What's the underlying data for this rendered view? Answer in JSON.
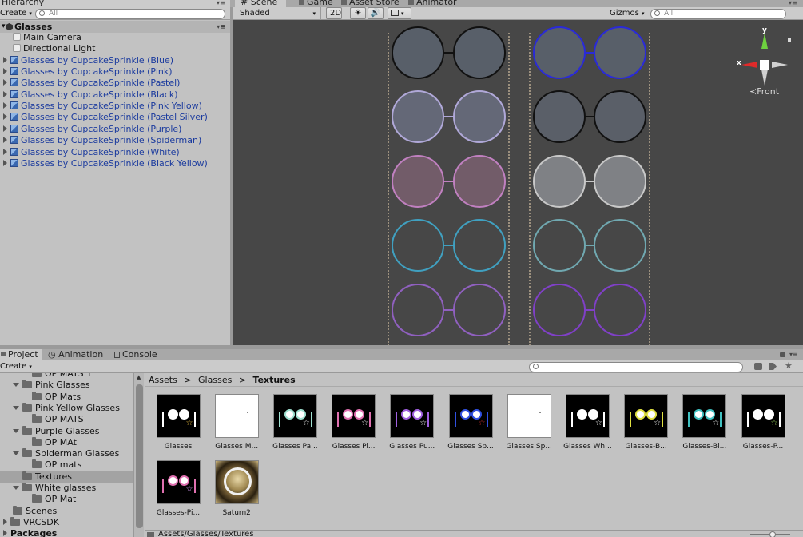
{
  "hierarchy": {
    "tab_label": "Hierarchy",
    "create_label": "Create",
    "search_placeholder": "All",
    "scene_name": "Glasses",
    "items": [
      {
        "label": "Main Camera",
        "prefab": false
      },
      {
        "label": "Directional Light",
        "prefab": false
      },
      {
        "label": "Glasses by CupcakeSprinkle (Blue)",
        "prefab": true
      },
      {
        "label": "Glasses by CupcakeSprinkle (Pink)",
        "prefab": true
      },
      {
        "label": "Glasses by CupcakeSprinkle (Pastel)",
        "prefab": true
      },
      {
        "label": "Glasses by CupcakeSprinkle (Black)",
        "prefab": true
      },
      {
        "label": "Glasses by CupcakeSprinkle (Pink Yellow)",
        "prefab": true
      },
      {
        "label": "Glasses by CupcakeSprinkle (Pastel Silver)",
        "prefab": true
      },
      {
        "label": "Glasses by CupcakeSprinkle (Purple)",
        "prefab": true
      },
      {
        "label": "Glasses by CupcakeSprinkle (Spiderman)",
        "prefab": true
      },
      {
        "label": "Glasses by CupcakeSprinkle (White)",
        "prefab": true
      },
      {
        "label": "Glasses by CupcakeSprinkle (Black Yellow)",
        "prefab": true
      }
    ]
  },
  "scene": {
    "tabs": [
      "Scene",
      "Game",
      "Asset Store",
      "Animator"
    ],
    "shading_mode": "Shaded",
    "mode_2d": "2D",
    "gizmos_label": "Gizmos",
    "search_placeholder": "All",
    "gizmo_axis_y": "y",
    "gizmo_axis_x": "x",
    "view_label": "Front",
    "background_color": "#474747"
  },
  "project": {
    "tabs": [
      "Project",
      "Animation",
      "Console"
    ],
    "create_label": "Create",
    "tree": [
      {
        "label": "OP MATS 1",
        "depth": 2,
        "expanded": null
      },
      {
        "label": "Pink Glasses",
        "depth": 1,
        "expanded": true
      },
      {
        "label": "OP Mats",
        "depth": 2,
        "expanded": null
      },
      {
        "label": "Pink Yellow Glasses",
        "depth": 1,
        "expanded": true
      },
      {
        "label": "OP MATS",
        "depth": 2,
        "expanded": null
      },
      {
        "label": "Purple Glasses",
        "depth": 1,
        "expanded": true
      },
      {
        "label": "OP MAt",
        "depth": 2,
        "expanded": null
      },
      {
        "label": "Spiderman Glasses",
        "depth": 1,
        "expanded": true
      },
      {
        "label": "OP mats",
        "depth": 2,
        "expanded": null
      },
      {
        "label": "Textures",
        "depth": 1,
        "expanded": null,
        "selected": true
      },
      {
        "label": "White glasses",
        "depth": 1,
        "expanded": true
      },
      {
        "label": "OP Mat",
        "depth": 2,
        "expanded": null
      },
      {
        "label": "Scenes",
        "depth": 0,
        "expanded": null
      },
      {
        "label": "VRCSDK",
        "depth": 0,
        "expanded": false
      },
      {
        "label": "Packages",
        "depth": 0,
        "expanded": false
      }
    ],
    "breadcrumb": [
      "Assets",
      "Glasses",
      "Textures"
    ],
    "status_path": "Assets/Glasses/Textures",
    "assets": [
      {
        "label": "Glasses",
        "style": "black",
        "frame": "#ffffff",
        "star": "#f0c040"
      },
      {
        "label": "Glasses M...",
        "style": "white",
        "frame": "#ffffff",
        "star": "#ffffff"
      },
      {
        "label": "Glasses Pa...",
        "style": "black",
        "frame": "#9fe0d0",
        "star": "#ffffff"
      },
      {
        "label": "Glasses Pi...",
        "style": "black",
        "frame": "#e070b0",
        "star": "#ffffff"
      },
      {
        "label": "Glasses Pu...",
        "style": "black",
        "frame": "#a060e0",
        "star": "#ffffff"
      },
      {
        "label": "Glasses Sp...",
        "style": "black",
        "frame": "#3050e0",
        "star": "#e03030"
      },
      {
        "label": "Glasses Sp...",
        "style": "white",
        "frame": "#ffffff",
        "star": "#ffffff"
      },
      {
        "label": "Glasses Wh...",
        "style": "black",
        "frame": "#ffffff",
        "star": "#ffffff"
      },
      {
        "label": "Glasses-B...",
        "style": "black",
        "frame": "#e0e040",
        "star": "#ffffff"
      },
      {
        "label": "Glasses-Bl...",
        "style": "black",
        "frame": "#40c0c0",
        "star": "#ffffff"
      },
      {
        "label": "Glasses-P...",
        "style": "black",
        "frame": "#ffffff",
        "star": "#a0e060"
      },
      {
        "label": "Glasses-Pi...",
        "style": "black",
        "frame": "#e070b0",
        "star": "#e0a0ff"
      },
      {
        "label": "Saturn2",
        "style": "saturn",
        "frame": "#ffffff",
        "star": "#ffffff"
      }
    ]
  }
}
